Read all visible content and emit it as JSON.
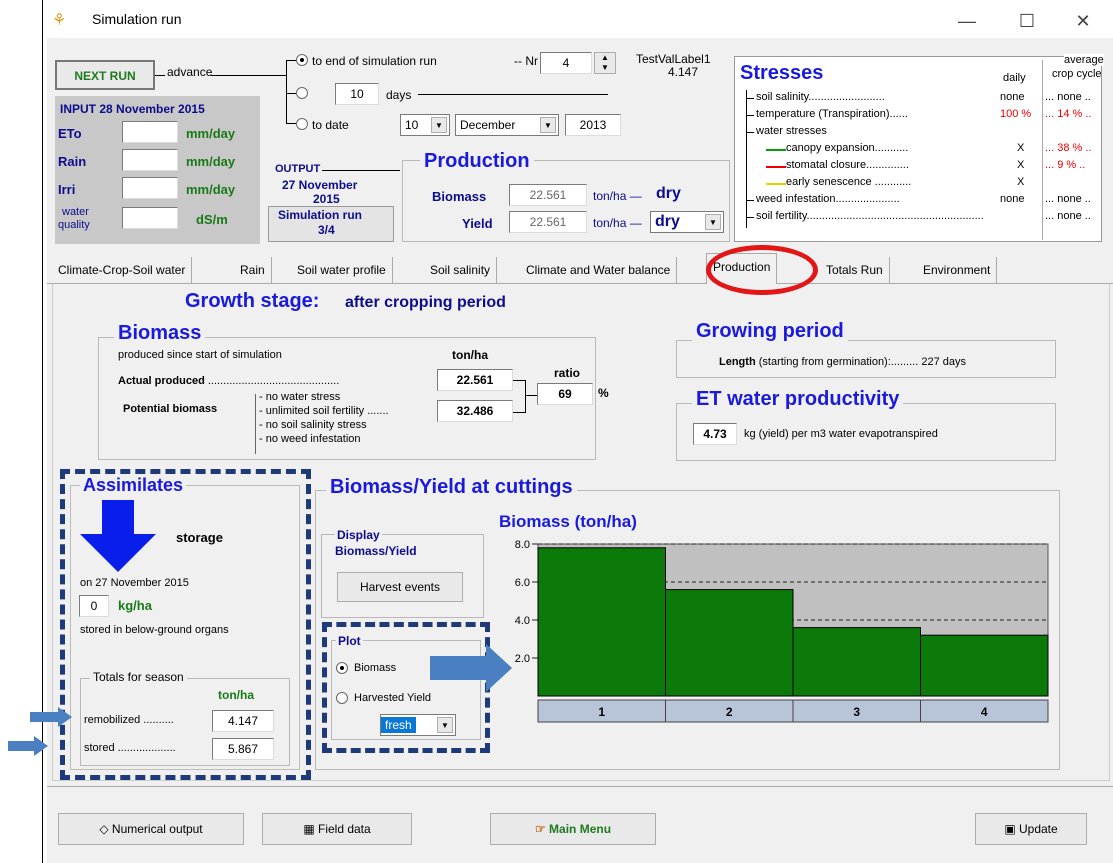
{
  "window": {
    "title": "Simulation run",
    "minimize": "—",
    "maximize": "☐",
    "close": "✕"
  },
  "top": {
    "next_run": "NEXT RUN",
    "advance": "advance",
    "opt_end": "to end of simulation run",
    "nr_label": "-- Nr",
    "nr_value": "4",
    "opt_days_value": "10",
    "opt_days_label": "days",
    "opt_date": "to date",
    "date_day": "10",
    "date_month": "December",
    "date_year": "2013",
    "test_label": "TestValLabel1",
    "test_value": "4.147"
  },
  "input": {
    "title": "INPUT",
    "date": "28 November 2015",
    "eto": "ETo",
    "eto_unit": "mm/day",
    "rain": "Rain",
    "rain_unit": "mm/day",
    "irri": "Irri",
    "irri_unit": "mm/day",
    "water": "water",
    "quality": "quality",
    "wq_unit": "dS/m"
  },
  "output": {
    "title": "OUTPUT",
    "date1": "27 November",
    "date2": "2015",
    "run1": "Simulation run",
    "run2": "3/4"
  },
  "production": {
    "title": "Production",
    "biomass_label": "Biomass",
    "biomass": "22.561",
    "unit1": "ton/ha —",
    "dry1": "dry",
    "yield_label": "Yield",
    "yield": "22.561",
    "unit2": "ton/ha —",
    "dry2": "dry"
  },
  "stresses": {
    "title": "Stresses",
    "daily": "daily",
    "avg1": "average",
    "avg2": "crop cycle",
    "rows": [
      {
        "label": "soil salinity.........................",
        "d": "none",
        "a": "... none .."
      },
      {
        "label": "temperature (Transpiration)......",
        "d": "100 %",
        "a": "... 14 % .."
      },
      {
        "label": "water stresses",
        "d": "",
        "a": ""
      },
      {
        "label": "canopy expansion...........",
        "d": "X",
        "a": "... 38 % .."
      },
      {
        "label": "stomatal closure..............",
        "d": "X",
        "a": "... 9 % .."
      },
      {
        "label": "early senescence ............",
        "d": "X",
        "a": ""
      },
      {
        "label": "weed infestation.....................",
        "d": "none",
        "a": "... none .."
      },
      {
        "label": "soil fertility..........................................................",
        "d": "",
        "a": "... none .."
      }
    ]
  },
  "tabs": [
    "Climate-Crop-Soil water",
    "Rain",
    "Soil water profile",
    "Soil salinity",
    "Climate and Water balance",
    "Production",
    "Totals Run",
    "Environment"
  ],
  "growth": {
    "label": "Growth stage:",
    "value": "after cropping period"
  },
  "biomass": {
    "title": "Biomass",
    "since": "produced since start of simulation",
    "unit": "ton/ha",
    "actual_label": "Actual produced ..........................................",
    "actual": "22.561",
    "ratio_label": "ratio",
    "ratio": "69",
    "pct": "%",
    "potential_label": "Potential biomass",
    "c1": "- no water stress",
    "c2": "- unlimited soil fertility .......",
    "c3": "- no soil salinity stress",
    "c4": "- no weed infestation",
    "potential": "32.486"
  },
  "growing": {
    "title": "Growing period",
    "length_label": "Length",
    "length_text": "(starting from germination):......... 227 days"
  },
  "etwp": {
    "title": "ET water productivity",
    "value": "4.73",
    "text": "kg (yield) per m3 water evapotranspired"
  },
  "assim": {
    "title": "Assimilates",
    "storage": "storage",
    "on": "on 27 November 2015",
    "value": "0",
    "unit": "kg/ha",
    "stored_in": "stored in below-ground organs",
    "totals": "Totals for season",
    "t_unit": "ton/ha",
    "remob_label": "remobilized ..........",
    "remob": "4.147",
    "stored_label": "stored ...................",
    "stored": "5.867"
  },
  "cuttings": {
    "title": "Biomass/Yield at cuttings",
    "display": "Display",
    "display2": "Biomass/Yield",
    "harvest": "Harvest events",
    "plot": "Plot",
    "opt1": "Biomass",
    "opt2": "Harvested Yield",
    "fresh": "fresh"
  },
  "chart_data": {
    "type": "bar",
    "title": "Biomass (ton/ha)",
    "categories": [
      "1",
      "2",
      "3",
      "4"
    ],
    "values": [
      7.8,
      5.6,
      3.6,
      3.2
    ],
    "ylim": [
      0,
      8
    ],
    "yticks": [
      "8.0",
      "6.0",
      "4.0",
      "2.0"
    ],
    "grid": true,
    "bar_color": "#0b7a0b",
    "bg_color": "#c0c0c0"
  },
  "bottom": {
    "numerical": "Numerical output",
    "field": "Field data",
    "main": "Main Menu",
    "update": "Update"
  }
}
